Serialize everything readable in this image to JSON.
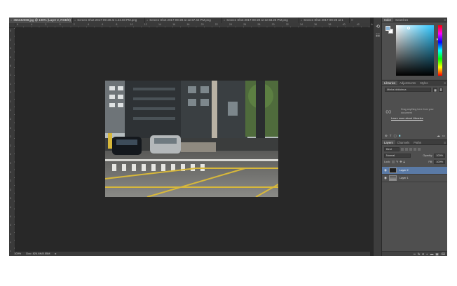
{
  "tabs": [
    {
      "label": "365342598.jpg @ 100% (Layer 2, RGB/8)",
      "active": true
    },
    {
      "label": "Screen Shot 2017-09-28 at 1.22.03 PM.png",
      "active": false
    },
    {
      "label": "Screen Shot 2017-09-28 at 12.57.42 PM.png",
      "active": false
    },
    {
      "label": "Screen Shot 2017-09-28 at 12.58.26 PM.png",
      "active": false
    },
    {
      "label": "Screen Shot 2017-09-28 at 1",
      "active": false
    }
  ],
  "tabs_more": "»",
  "ruler_top_labels": [
    "6",
    "4",
    "2",
    "0",
    "2",
    "4",
    "6",
    "8",
    "10",
    "12",
    "14",
    "16",
    "18",
    "20",
    "22",
    "24",
    "26",
    "28",
    "30",
    "32",
    "34",
    "36",
    "38",
    "40",
    "42",
    "44"
  ],
  "ruler_left_labels": [
    "0",
    "2",
    "4",
    "6",
    "8",
    "1",
    "1",
    "1",
    "1",
    "1",
    "2",
    "2",
    "2",
    "2",
    "2",
    "3",
    "3",
    "3",
    "3",
    "3",
    "4",
    "4",
    "4",
    "4",
    "4",
    "5"
  ],
  "status": {
    "zoom": "100%",
    "doc": "Doc: 824.6K/8.55M",
    "arrow": "▸"
  },
  "strip_icons": [
    "history-icon",
    "properties-icon"
  ],
  "color_panel": {
    "tabs": [
      "Color",
      "Swatches"
    ],
    "foreground": "#8ab4d6",
    "background": "#ffffff"
  },
  "libraries_panel": {
    "tabs": [
      "Libraries",
      "Adjustments",
      "Styles"
    ],
    "library_name": "Minha biblioteca",
    "message": "Drag anything here from your document",
    "link": "Learn more about Libraries"
  },
  "layers_panel": {
    "tabs": [
      "Layers",
      "Channels",
      "Paths"
    ],
    "filter_kind": "Kind",
    "blend_mode": "Normal",
    "opacity_label": "Opacity:",
    "opacity_value": "100%",
    "lock_label": "Lock:",
    "fill_label": "Fill:",
    "fill_value": "100%",
    "layers": [
      {
        "name": "Layer 2",
        "selected": true
      },
      {
        "name": "Layer 1",
        "selected": false
      }
    ]
  },
  "colors": {
    "accent_selection": "#5a7aa6",
    "workspace": "#282828",
    "panel": "#4f4f4f"
  }
}
